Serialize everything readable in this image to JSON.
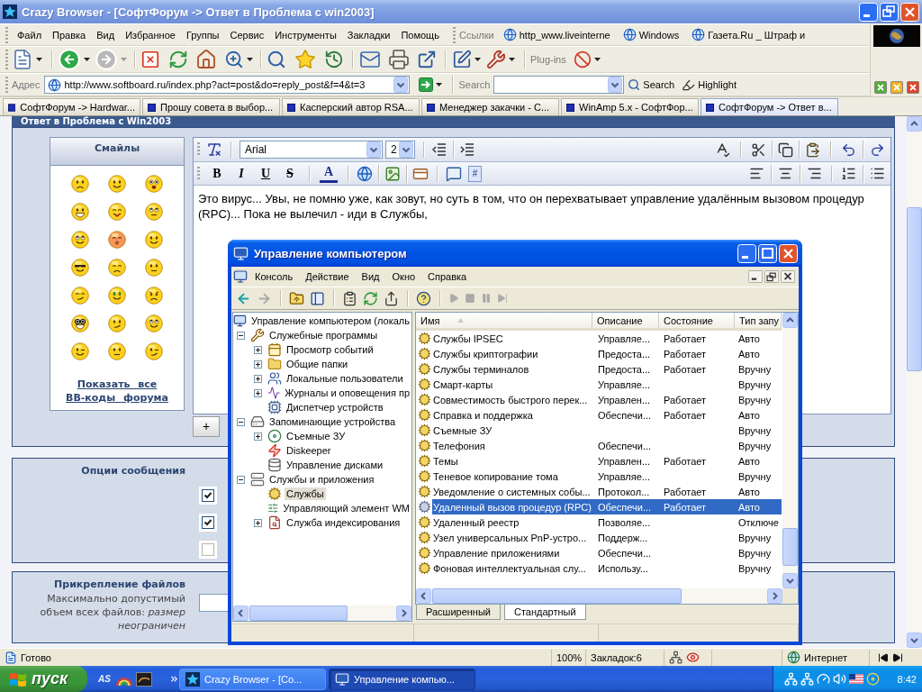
{
  "window": {
    "title": "Crazy Browser - [СофтФорум -> Ответ в Проблема с win2003]"
  },
  "menu": [
    "Файл",
    "Правка",
    "Вид",
    "Избранное",
    "Группы",
    "Сервис",
    "Инструменты",
    "Закладки",
    "Помощь"
  ],
  "links": {
    "label": "Ссылки",
    "items": [
      "http_www.liveinterne",
      "Windows",
      "Газета.Ru _ Штраф и"
    ]
  },
  "toolbar": {
    "plugins_label": "Plug-ins"
  },
  "address": {
    "label": "Адрес",
    "value": "http://www.softboard.ru/index.php?act=post&do=reply_post&f=4&t=3"
  },
  "search": {
    "label": "Search",
    "button": "Search",
    "highlight": "Highlight"
  },
  "tabs": [
    {
      "label": "СофтФорум -> Hardwar...",
      "selected": false
    },
    {
      "label": "Прошу совета в выбор...",
      "selected": false
    },
    {
      "label": "Касперский автор RSA...",
      "selected": false
    },
    {
      "label": "Менеджер закачки - С...",
      "selected": false
    },
    {
      "label": "WinAmp 5.x - СофтФор...",
      "selected": false
    },
    {
      "label": "СофтФорум -> Ответ в...",
      "selected": true
    }
  ],
  "page": {
    "heading": "Ответ в Проблема с Win2003",
    "smileys": {
      "title": "Смайлы",
      "faces": [
        {
          "kind": "sad"
        },
        {
          "kind": "smile"
        },
        {
          "kind": "surprised"
        },
        {
          "kind": "grin"
        },
        {
          "kind": "tongue"
        },
        {
          "kind": "rolleyes"
        },
        {
          "kind": "thumbs"
        },
        {
          "kind": "blush"
        },
        {
          "kind": "ear"
        },
        {
          "kind": "cool"
        },
        {
          "kind": "frustrated"
        },
        {
          "kind": "neutral"
        },
        {
          "kind": "think"
        },
        {
          "kind": "dollar"
        },
        {
          "kind": "angry"
        },
        {
          "kind": "nerd"
        },
        {
          "kind": "unsure"
        },
        {
          "kind": "happy"
        },
        {
          "kind": "wink"
        },
        {
          "kind": "bandage"
        },
        {
          "kind": "smirk"
        }
      ],
      "link": "Показать все BB-коды форума"
    },
    "editor": {
      "font": "Arial",
      "size": "2",
      "format_buttons": [
        {
          "kind": "bold",
          "label": "B"
        },
        {
          "kind": "italic",
          "label": "I"
        },
        {
          "kind": "underline",
          "label": "U"
        },
        {
          "kind": "strike",
          "label": "S"
        }
      ],
      "color_button": "A",
      "code_button": "#",
      "text": "Это вирус... Увы, не помню уже, как зовут, но суть в том, что он перехватывает управление удалённым вызовом процедур (RPC)... Пока не вылечил - иди в Службы,",
      "add_button": "+"
    },
    "options": {
      "title": "Опции сообщения",
      "checkboxes": [
        {
          "checked": true
        },
        {
          "checked": true
        },
        {
          "checked": false
        }
      ]
    },
    "attachments": {
      "title": "Прикрепление файлов",
      "note": "Максимально допустимый объем всех файлов: *размер неограничен*"
    }
  },
  "mmc": {
    "title": "Управление компьютером",
    "menu": [
      "Консоль",
      "Действие",
      "Вид",
      "Окно",
      "Справка"
    ],
    "tree": [
      {
        "label": "Управление компьютером (локаль",
        "kind": "computer",
        "selected": false,
        "children": [
          {
            "label": "Служебные программы",
            "kind": "tools",
            "expanded": true,
            "selected": false,
            "children": [
              {
                "label": "Просмотр событий",
                "kind": "events",
                "expanded": false,
                "selected": false
              },
              {
                "label": "Общие папки",
                "kind": "folder",
                "expanded": false,
                "selected": false
              },
              {
                "label": "Локальные пользователи",
                "kind": "users",
                "expanded": false,
                "selected": false
              },
              {
                "label": "Журналы и оповещения пр",
                "kind": "logs",
                "expanded": false,
                "selected": false
              },
              {
                "label": "Диспетчер устройств",
                "kind": "devices",
                "selected": false
              }
            ]
          },
          {
            "label": "Запоминающие устройства",
            "kind": "storage",
            "expanded": true,
            "selected": false,
            "children": [
              {
                "label": "Съемные ЗУ",
                "kind": "removable",
                "expanded": false,
                "selected": false
              },
              {
                "label": "Diskeeper",
                "kind": "defrag",
                "selected": false
              },
              {
                "label": "Управление дисками",
                "kind": "disk",
                "selected": false
              }
            ]
          },
          {
            "label": "Службы и приложения",
            "kind": "apps",
            "expanded": true,
            "selected": false,
            "children": [
              {
                "label": "Службы",
                "kind": "services",
                "selected": true
              },
              {
                "label": "Управляющий элемент WM",
                "kind": "wmi",
                "selected": false
              },
              {
                "label": "Служба индексирования",
                "kind": "index",
                "expanded": false,
                "selected": false
              }
            ]
          }
        ]
      }
    ],
    "columns": [
      "Имя",
      "Описание",
      "Состояние",
      "Тип запу"
    ],
    "rows": [
      {
        "name": "Службы IPSEC",
        "description": "Управляе...",
        "status": "Работает",
        "startup": "Авто",
        "selected": false
      },
      {
        "name": "Службы криптографии",
        "description": "Предоста...",
        "status": "Работает",
        "startup": "Авто",
        "selected": false
      },
      {
        "name": "Службы терминалов",
        "description": "Предоста...",
        "status": "Работает",
        "startup": "Вручну",
        "selected": false
      },
      {
        "name": "Смарт-карты",
        "description": "Управляе...",
        "startup": "Вручну",
        "selected": false
      },
      {
        "name": "Совместимость быстрого перек...",
        "description": "Управлен...",
        "status": "Работает",
        "startup": "Вручну",
        "selected": false
      },
      {
        "name": "Справка и поддержка",
        "description": "Обеспечи...",
        "status": "Работает",
        "startup": "Авто",
        "selected": false
      },
      {
        "name": "Съемные ЗУ",
        "startup": "Вручну",
        "selected": false
      },
      {
        "name": "Телефония",
        "description": "Обеспечи...",
        "startup": "Вручну",
        "selected": false
      },
      {
        "name": "Темы",
        "description": "Управлен...",
        "status": "Работает",
        "startup": "Авто",
        "selected": false
      },
      {
        "name": "Теневое копирование тома",
        "description": "Управляе...",
        "startup": "Вручну",
        "selected": false
      },
      {
        "name": "Уведомление о системных собы...",
        "description": "Протокол...",
        "status": "Работает",
        "startup": "Авто",
        "selected": false
      },
      {
        "name": "Удаленный вызов процедур (RPC)",
        "description": "Обеспечи...",
        "status": "Работает",
        "startup": "Авто",
        "selected": true
      },
      {
        "name": "Удаленный реестр",
        "description": "Позволяе...",
        "startup": "Отключе",
        "selected": false
      },
      {
        "name": "Узел универсальных PnP-устро...",
        "description": "Поддерж...",
        "startup": "Вручну",
        "selected": false
      },
      {
        "name": "Управление приложениями",
        "description": "Обеспечи...",
        "startup": "Вручну",
        "selected": false
      },
      {
        "name": "Фоновая интеллектуальная слу...",
        "description": "Использу...",
        "startup": "Вручну",
        "selected": false
      }
    ],
    "view_tabs": [
      {
        "label": "Расширенный",
        "selected": false
      },
      {
        "label": "Стандартный",
        "selected": true
      }
    ]
  },
  "status_bar": {
    "text": "Готово",
    "zoom": "100%",
    "bookmarks": "Закладок:6",
    "zone": "Интернет"
  },
  "taskbar": {
    "start": "пуск",
    "quick_launch": [
      {
        "kind": "text",
        "label": "AS"
      },
      {
        "kind": "rainbow"
      },
      {
        "kind": "screen"
      }
    ],
    "tasks": [
      {
        "label": "Crazy Browser - [Co...",
        "kind": "browser",
        "selected": false
      },
      {
        "label": "Управление компью...",
        "kind": "console",
        "selected": true
      }
    ],
    "clock": "8:42"
  }
}
